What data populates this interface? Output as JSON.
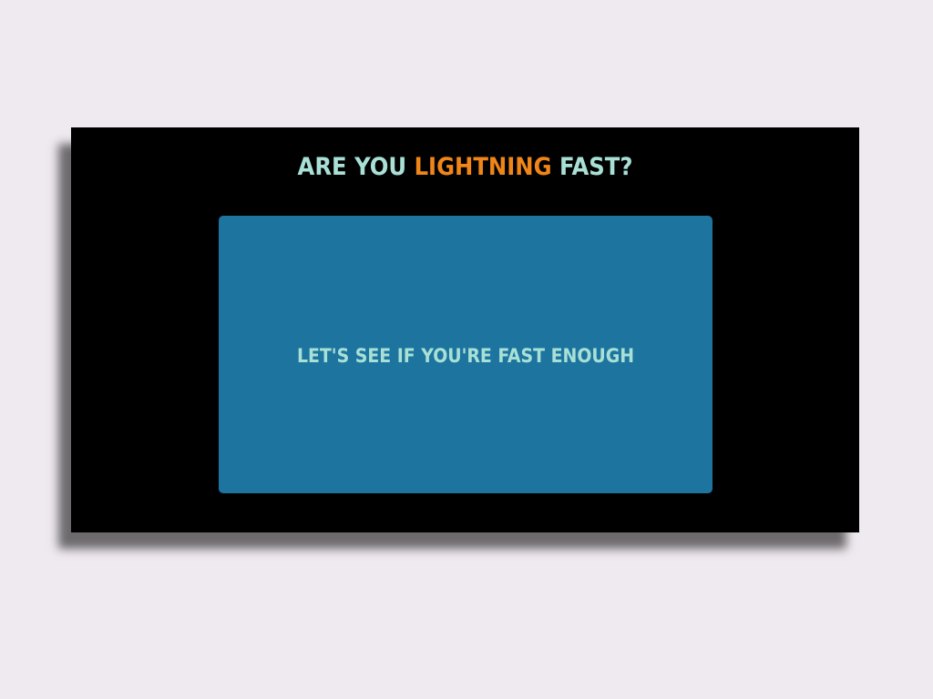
{
  "game": {
    "title_part1": "ARE YOU",
    "title_accent": "LIGHTNING",
    "title_part2": "FAST?",
    "prompt": "LET'S SEE IF YOU'RE FAST ENOUGH"
  },
  "colors": {
    "page_background": "#efeaef",
    "window_background": "#000000",
    "title_text": "#a9e0d6",
    "accent_text": "#f08618",
    "play_area": "#1c749f"
  }
}
